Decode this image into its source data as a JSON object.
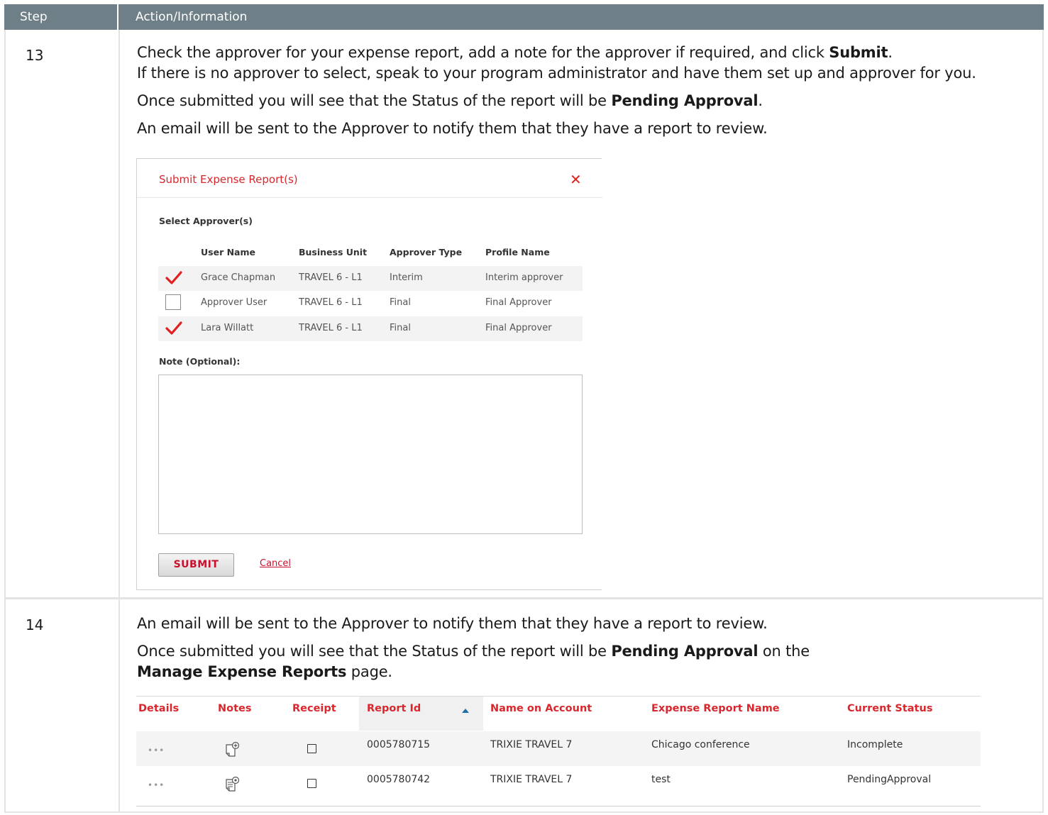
{
  "header": {
    "col_step": "Step",
    "col_action": "Action/Information"
  },
  "steps": [
    {
      "number": "13",
      "p1_pre": "Check the approver for your expense report, add a note for the approver if required, and click ",
      "p1_bold": "Submit",
      "p1_post": ".",
      "p2": "If there is no approver to select, speak to your program administrator and have them set up and approver for you.",
      "p3_pre": "Once submitted you will see that the Status of the report will be ",
      "p3_bold": "Pending Approval",
      "p3_post": ".",
      "p4": "An email will be sent to the Approver to notify them that they have a report to review."
    },
    {
      "number": "14",
      "p1": "An email will be sent to the Approver to notify them that they have a report to review.",
      "p2_pre": "Once submitted you will see that the Status of the report will be ",
      "p2_bold": "Pending Approval",
      "p2_mid": " on the",
      "p2_bold2": "Manage Expense Reports",
      "p2_post": " page."
    }
  ],
  "dialog": {
    "title": "Submit Expense Report(s)",
    "close_glyph": "✕",
    "select_label": "Select Approver(s)",
    "columns": [
      "User Name",
      "Business Unit",
      "Approver Type",
      "Profile Name"
    ],
    "approvers": [
      {
        "user": "Grace Chapman",
        "unit": "TRAVEL 6 - L1",
        "type": "Interim",
        "profile": "Interim approver",
        "checked": true
      },
      {
        "user": "Approver User",
        "unit": "TRAVEL 6 - L1",
        "type": "Final",
        "profile": "Final Approver",
        "checked": false
      },
      {
        "user": "Lara Willatt",
        "unit": "TRAVEL 6 - L1",
        "type": "Final",
        "profile": "Final Approver",
        "checked": true
      }
    ],
    "note_label": "Note (Optional):",
    "note_value": "",
    "submit_label": "SUBMIT",
    "cancel_label": "Cancel"
  },
  "reports": {
    "columns": [
      "Details",
      "Notes",
      "Receipt",
      "Report Id",
      "Name on Account",
      "Expense Report Name",
      "Current Status"
    ],
    "sort": {
      "column": "Report Id",
      "direction": "ascending"
    },
    "rows": [
      {
        "details": "•••",
        "report_id": "0005780715",
        "name": "TRIXIE TRAVEL 7",
        "report_name": "Chicago conference",
        "status": "Incomplete"
      },
      {
        "details": "•••",
        "report_id": "0005780742",
        "name": "TRIXIE TRAVEL 7",
        "report_name": "test",
        "status": "PendingApproval"
      }
    ]
  },
  "colors": {
    "header_bg": "#6f7f88",
    "accent_red": "#d9272e",
    "check_red": "#e02020"
  }
}
